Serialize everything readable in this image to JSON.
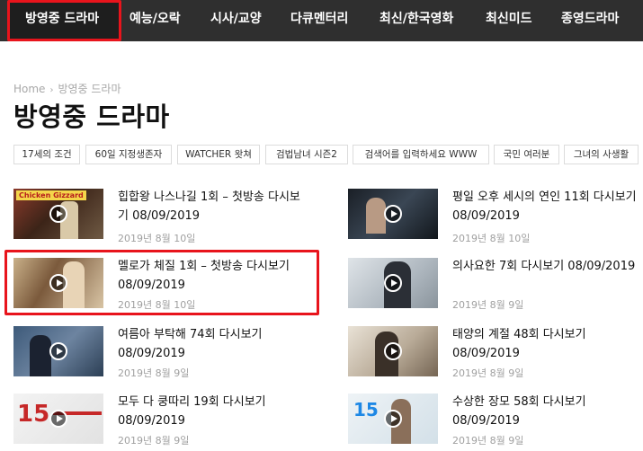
{
  "nav": {
    "items": [
      {
        "label": "방영중 드라마"
      },
      {
        "label": "예능/오락"
      },
      {
        "label": "시사/교양"
      },
      {
        "label": "다큐멘터리"
      },
      {
        "label": "최신/한국영화"
      },
      {
        "label": "최신미드"
      },
      {
        "label": "종영드라마"
      }
    ]
  },
  "breadcrumb": {
    "home": "Home",
    "separator": "›",
    "current": "방영중 드라마"
  },
  "page_title": "방영중 드라마",
  "tags": [
    "17세의 조건",
    "60일 지정생존자",
    "WATCHER 왓쳐",
    "검법남녀 시즌2",
    "검색어를 입력하세요 WWW",
    "국민 여러분",
    "그녀의 사생활"
  ],
  "posts": [
    {
      "title": "힙합왕 나스나길 1회 – 첫방송 다시보기 08/09/2019",
      "date": "2019년 8월 10일",
      "thumb_text": "Chicken Gizzard"
    },
    {
      "title": "평일 오후 세시의 연인 11회 다시보기 08/09/2019",
      "date": "2019년 8월 10일"
    },
    {
      "title": "멜로가 체질 1회 – 첫방송 다시보기 08/09/2019",
      "date": "2019년 8월 10일"
    },
    {
      "title": "의사요한 7회 다시보기 08/09/2019",
      "date": "2019년 8월 9일"
    },
    {
      "title": "여름아 부탁해 74회 다시보기 08/09/2019",
      "date": "2019년 8월 9일"
    },
    {
      "title": "태양의 계절 48회 다시보기 08/09/2019",
      "date": "2019년 8월 9일"
    },
    {
      "title": "모두 다 쿵따리 19회 다시보기 08/09/2019",
      "date": "2019년 8월 9일"
    },
    {
      "title": "수상한 장모 58회 다시보기 08/09/2019",
      "date": "2019년 8월 9일"
    }
  ],
  "colors": {
    "nav_bg": "#2f2f2f",
    "highlight": "#e8141c",
    "meta_text": "#a0a0a0"
  },
  "icons": {
    "play": "play-icon"
  }
}
